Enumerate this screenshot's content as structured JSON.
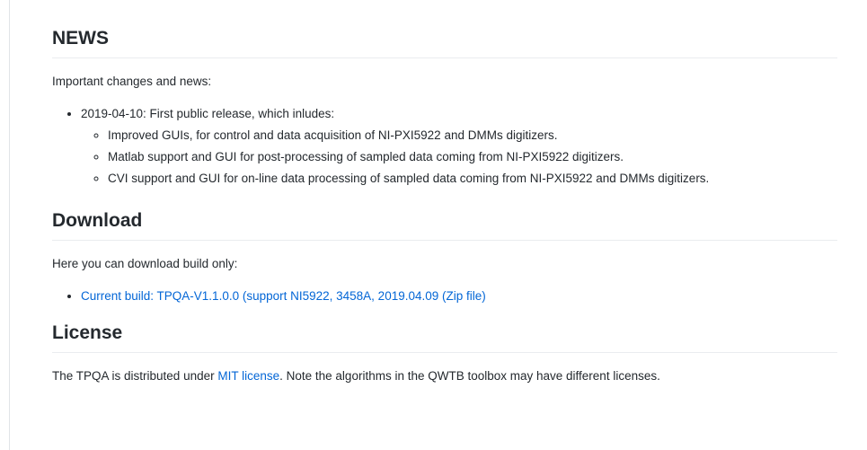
{
  "news": {
    "heading": "NEWS",
    "intro": "Important changes and news:",
    "release": {
      "label": "2019-04-10: First public release, which inludes:",
      "items": [
        "Improved GUIs, for control and data acquisition of NI-PXI5922 and DMMs digitizers.",
        "Matlab support and GUI for post-processing of sampled data coming from NI-PXI5922 digitizers.",
        "CVI support and GUI for on-line data processing of sampled data coming from NI-PXI5922 and DMMs digitizers."
      ]
    }
  },
  "download": {
    "heading": "Download",
    "intro": "Here you can download build only:",
    "link_text": "Current build: TPQA-V1.1.0.0 (support NI5922, 3458A, 2019.04.09 (Zip file)"
  },
  "license": {
    "heading": "License",
    "text_before": "The TPQA is distributed under ",
    "link_text": "MIT license",
    "text_after": ". Note the algorithms in the QWTB toolbox may have different licenses."
  }
}
